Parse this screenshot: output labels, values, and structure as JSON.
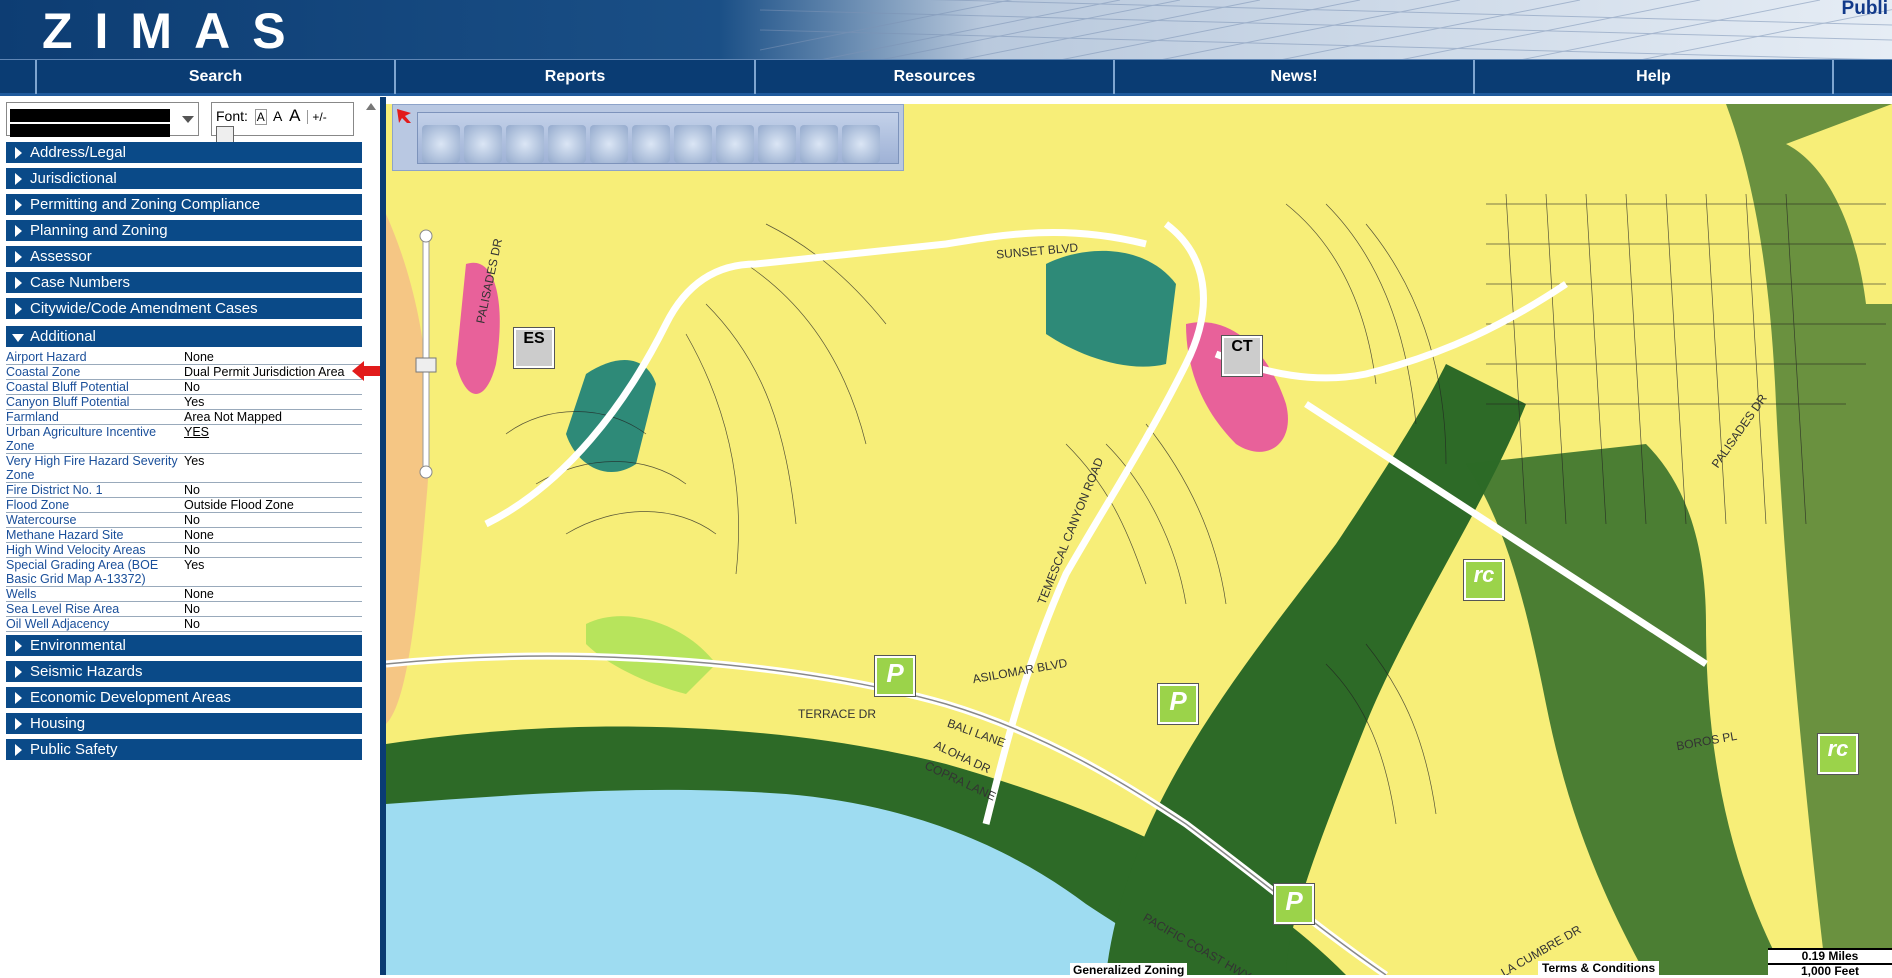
{
  "header": {
    "logo": "ZIMAS",
    "public_label": "Publi"
  },
  "nav": {
    "items": [
      "Search",
      "Reports",
      "Resources",
      "News!",
      "Help"
    ]
  },
  "sidebar": {
    "font_label": "Font:",
    "font_sizes": [
      "A",
      "A",
      "A"
    ],
    "font_toggle": "+/-",
    "sections_top": [
      "Address/Legal",
      "Jurisdictional",
      "Permitting and Zoning Compliance",
      "Planning and Zoning",
      "Assessor",
      "Case Numbers",
      "Citywide/Code Amendment Cases"
    ],
    "expanded_section": "Additional",
    "rows": [
      {
        "k": "Airport Hazard",
        "v": "None"
      },
      {
        "k": "Coastal Zone",
        "v": "Dual Permit Jurisdiction Area"
      },
      {
        "k": "Coastal Bluff Potential",
        "v": "No"
      },
      {
        "k": "Canyon Bluff Potential",
        "v": "Yes"
      },
      {
        "k": "Farmland",
        "v": "Area Not Mapped"
      },
      {
        "k": "Urban Agriculture Incentive Zone",
        "v": "YES"
      },
      {
        "k": "Very High Fire Hazard Severity Zone",
        "v": "Yes"
      },
      {
        "k": "Fire District No. 1",
        "v": "No"
      },
      {
        "k": "Flood Zone",
        "v": "Outside Flood Zone"
      },
      {
        "k": "Watercourse",
        "v": "No"
      },
      {
        "k": "Methane Hazard Site",
        "v": "None"
      },
      {
        "k": "High Wind Velocity Areas",
        "v": "No"
      },
      {
        "k": "Special Grading Area (BOE Basic Grid Map A-13372)",
        "v": "Yes"
      },
      {
        "k": "Wells",
        "v": "None"
      },
      {
        "k": "Sea Level Rise Area",
        "v": "No"
      },
      {
        "k": "Oil Well Adjacency",
        "v": "No"
      }
    ],
    "sections_bottom": [
      "Environmental",
      "Seismic Hazards",
      "Economic Development Areas",
      "Housing",
      "Public Safety"
    ]
  },
  "map": {
    "street_labels": [
      "PALISADES DR",
      "TERRACE DR",
      "BALI LANE",
      "ALOHA DR",
      "COPRA LANE",
      "SUNSET BLVD",
      "TEMESCAL CANYON ROAD",
      "PACIFIC COAST HWY",
      "LA CUMBRE DR",
      "PALISADES DR",
      "ASILOMAR BLVD",
      "BOROS PL"
    ],
    "icons": [
      "ES",
      "CT",
      "P",
      "P",
      "P",
      "rc",
      "rc"
    ],
    "legend_title": "Generalized Zoning",
    "terms": "Terms & Conditions",
    "scale_miles": "0.19 Miles",
    "scale_feet": "1,000 Feet"
  },
  "colors": {
    "nav": "#0a3c73",
    "section": "#0a4a88",
    "residential": "#f7ee78",
    "openspace": "#2d6a27",
    "water": "#9edcf1",
    "park": "#2e8a78",
    "commercial": "#e8619a"
  }
}
